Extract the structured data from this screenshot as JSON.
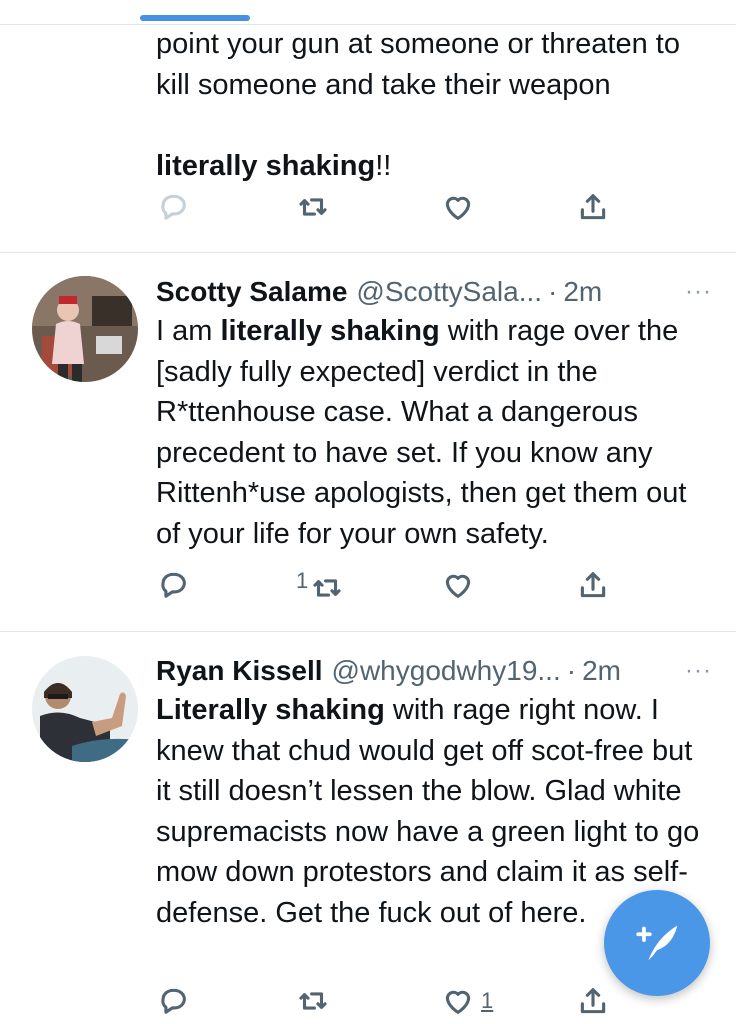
{
  "tweets": [
    {
      "text_parts": [
        {
          "t": "point your gun at someone or threaten to kill someone and take their weapon",
          "b": false
        },
        {
          "t": "literally shaking",
          "b": true
        },
        {
          "t": "!!",
          "b": false
        }
      ],
      "actions": {
        "reply": "",
        "retweet": "",
        "like": ""
      }
    },
    {
      "name": "Scotty Salame",
      "handle": "@ScottySala...",
      "dot": "·",
      "time": "2m",
      "more": "···",
      "text_parts": [
        {
          "t": "I am ",
          "b": false
        },
        {
          "t": "literally shaking",
          "b": true
        },
        {
          "t": " with rage over the [sadly fully expected] verdict in the R*ttenhouse case. What a dangerous precedent to have set. If you know any Rittenh*use apologists, then get them out of your life for your own safety.",
          "b": false
        }
      ],
      "actions": {
        "reply": "",
        "retweet": "1",
        "like": ""
      }
    },
    {
      "name": "Ryan Kissell",
      "handle": "@whygodwhy19...",
      "dot": "·",
      "time": "2m",
      "more": "···",
      "text_parts": [
        {
          "t": "Literally shaking",
          "b": true
        },
        {
          "t": " with rage right now. I knew that chud would get off scot-free but it still doesn’t lessen the blow. Glad white supremacists now have a green light to go mow down protestors and claim it as self-defense. Get the fuck out of here.",
          "b": false
        }
      ],
      "actions": {
        "reply": "",
        "retweet": "",
        "like": "1"
      }
    }
  ],
  "icons": {
    "reply": "reply-icon",
    "retweet": "retweet-icon",
    "like": "heart-icon",
    "share": "share-icon",
    "compose": "compose-tweet-icon"
  },
  "colors": {
    "accent": "#4a97e8",
    "secondary_text": "#536471",
    "divider": "#e1e8ed"
  }
}
